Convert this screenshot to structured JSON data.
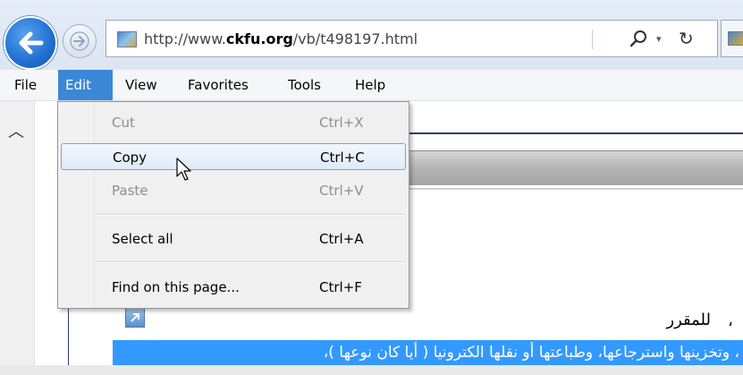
{
  "browser": {
    "url_prefix": "http://www.",
    "url_domain": "ckfu.org",
    "url_path": "/vb/t498197.html",
    "dropdown_glyph": "▾",
    "refresh_glyph": "↻"
  },
  "menubar": {
    "items": [
      {
        "label": "File"
      },
      {
        "label": "Edit"
      },
      {
        "label": "View"
      },
      {
        "label": "Favorites"
      },
      {
        "label": "Tools"
      },
      {
        "label": "Help"
      }
    ],
    "active": "Edit"
  },
  "edit_menu": {
    "items": [
      {
        "label": "Cut",
        "shortcut": "Ctrl+X",
        "enabled": false
      },
      {
        "label": "Copy",
        "shortcut": "Ctrl+C",
        "enabled": true,
        "hovered": true
      },
      {
        "label": "Paste",
        "shortcut": "Ctrl+V",
        "enabled": false
      },
      {
        "label": "Select all",
        "shortcut": "Ctrl+A",
        "enabled": true
      },
      {
        "label": "Find on this page...",
        "shortcut": "Ctrl+F",
        "enabled": true
      }
    ]
  },
  "page": {
    "heading_fragment": "للمقرر",
    "leading_mark": "،",
    "selected_text": "، وتخزينها واسترجاعها، وطباعتها أو نقلها الكترونيا ( أيا كان نوعها )،"
  },
  "colors": {
    "menu_active": "#3a87d6",
    "selection": "#3399ff",
    "back_button": "#1f6fd0"
  },
  "icons": [
    "back-arrow-icon",
    "forward-arrow-icon",
    "site-favicon-icon",
    "search-icon",
    "refresh-icon",
    "collapse-chevron-icon",
    "external-link-icon",
    "mouse-cursor-icon"
  ]
}
